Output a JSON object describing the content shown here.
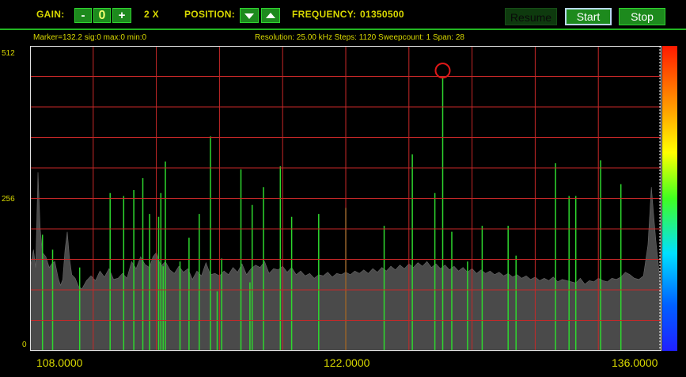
{
  "toolbar": {
    "gain_label": "GAIN:",
    "gain_minus": "-",
    "gain_value": "0",
    "gain_plus": "+",
    "multiplier": "2 X",
    "position_label": "POSITION:",
    "position_down_icon": "triangle-down-icon",
    "position_up_icon": "triangle-up-icon",
    "frequency_label": "FREQUENCY:",
    "frequency_value": "01350500",
    "resume_label": "Resume",
    "start_label": "Start",
    "stop_label": "Stop"
  },
  "info": {
    "marker": "Marker=132.2 sig:0 max:0 min:0",
    "resolution": "Resolution: 25.00 kHz Steps: 1120 Sweepcount: 1 Span: 28"
  },
  "colors": {
    "label": "#d8d800",
    "grid": "#c82828",
    "trace": "#4a4a4a",
    "peaks": "#2ed82e",
    "button": "#1d8a1d",
    "marker": "#e01818"
  },
  "chart_data": {
    "type": "area",
    "xlim": [
      108,
      136
    ],
    "ylim": [
      0,
      512
    ],
    "y_ticks": [
      "512",
      "256",
      "0"
    ],
    "x_ticks": [
      "108.0000",
      "122.0000",
      "136.0000"
    ],
    "grid": true,
    "marker_x": 132.2,
    "noise_floor": 135,
    "spectrum": [
      [
        108.0,
        138
      ],
      [
        108.15,
        170
      ],
      [
        108.25,
        140
      ],
      [
        108.35,
        300
      ],
      [
        108.45,
        205
      ],
      [
        108.55,
        165
      ],
      [
        108.7,
        158
      ],
      [
        108.85,
        140
      ],
      [
        109.0,
        148
      ],
      [
        109.1,
        150
      ],
      [
        109.25,
        122
      ],
      [
        109.35,
        110
      ],
      [
        109.45,
        120
      ],
      [
        109.55,
        170
      ],
      [
        109.65,
        200
      ],
      [
        109.75,
        155
      ],
      [
        109.85,
        128
      ],
      [
        110.0,
        122
      ],
      [
        110.15,
        108
      ],
      [
        110.3,
        104
      ],
      [
        110.5,
        118
      ],
      [
        110.7,
        126
      ],
      [
        110.9,
        118
      ],
      [
        111.1,
        134
      ],
      [
        111.3,
        124
      ],
      [
        111.5,
        138
      ],
      [
        111.7,
        120
      ],
      [
        111.9,
        122
      ],
      [
        112.1,
        130
      ],
      [
        112.3,
        122
      ],
      [
        112.5,
        150
      ],
      [
        112.7,
        138
      ],
      [
        112.9,
        158
      ],
      [
        113.1,
        145
      ],
      [
        113.3,
        140
      ],
      [
        113.45,
        158
      ],
      [
        113.6,
        165
      ],
      [
        113.8,
        142
      ],
      [
        114.0,
        150
      ],
      [
        114.2,
        136
      ],
      [
        114.4,
        130
      ],
      [
        114.6,
        142
      ],
      [
        114.8,
        132
      ],
      [
        115.0,
        138
      ],
      [
        115.2,
        120
      ],
      [
        115.4,
        134
      ],
      [
        115.6,
        126
      ],
      [
        115.8,
        148
      ],
      [
        116.0,
        128
      ],
      [
        116.2,
        130
      ],
      [
        116.4,
        126
      ],
      [
        116.6,
        134
      ],
      [
        116.8,
        128
      ],
      [
        117.0,
        140
      ],
      [
        117.2,
        132
      ],
      [
        117.4,
        146
      ],
      [
        117.6,
        128
      ],
      [
        117.8,
        138
      ],
      [
        118.0,
        144
      ],
      [
        118.2,
        140
      ],
      [
        118.4,
        150
      ],
      [
        118.6,
        130
      ],
      [
        118.8,
        138
      ],
      [
        119.0,
        136
      ],
      [
        119.2,
        142
      ],
      [
        119.4,
        132
      ],
      [
        119.6,
        140
      ],
      [
        119.8,
        128
      ],
      [
        120.0,
        134
      ],
      [
        120.2,
        126
      ],
      [
        120.4,
        130
      ],
      [
        120.6,
        122
      ],
      [
        120.8,
        128
      ],
      [
        121.0,
        126
      ],
      [
        121.2,
        132
      ],
      [
        121.4,
        124
      ],
      [
        121.6,
        130
      ],
      [
        121.8,
        128
      ],
      [
        122.0,
        132
      ],
      [
        122.2,
        128
      ],
      [
        122.4,
        134
      ],
      [
        122.6,
        130
      ],
      [
        122.8,
        136
      ],
      [
        123.0,
        130
      ],
      [
        123.2,
        138
      ],
      [
        123.4,
        132
      ],
      [
        123.6,
        140
      ],
      [
        123.8,
        134
      ],
      [
        124.0,
        142
      ],
      [
        124.2,
        136
      ],
      [
        124.4,
        144
      ],
      [
        124.6,
        138
      ],
      [
        124.8,
        146
      ],
      [
        125.0,
        140
      ],
      [
        125.2,
        148
      ],
      [
        125.4,
        142
      ],
      [
        125.6,
        150
      ],
      [
        125.8,
        140
      ],
      [
        126.0,
        146
      ],
      [
        126.2,
        138
      ],
      [
        126.4,
        144
      ],
      [
        126.6,
        136
      ],
      [
        126.8,
        142
      ],
      [
        127.0,
        134
      ],
      [
        127.2,
        140
      ],
      [
        127.4,
        132
      ],
      [
        127.6,
        138
      ],
      [
        127.8,
        130
      ],
      [
        128.0,
        136
      ],
      [
        128.2,
        130
      ],
      [
        128.4,
        134
      ],
      [
        128.6,
        128
      ],
      [
        128.8,
        132
      ],
      [
        129.0,
        126
      ],
      [
        129.2,
        130
      ],
      [
        129.4,
        124
      ],
      [
        129.6,
        128
      ],
      [
        129.8,
        122
      ],
      [
        130.0,
        126
      ],
      [
        130.2,
        120
      ],
      [
        130.4,
        124
      ],
      [
        130.6,
        118
      ],
      [
        130.8,
        122
      ],
      [
        131.0,
        118
      ],
      [
        131.2,
        124
      ],
      [
        131.4,
        116
      ],
      [
        131.6,
        120
      ],
      [
        131.8,
        118
      ],
      [
        132.0,
        116
      ],
      [
        132.2,
        114
      ],
      [
        132.4,
        122
      ],
      [
        132.6,
        112
      ],
      [
        132.8,
        118
      ],
      [
        133.0,
        116
      ],
      [
        133.2,
        122
      ],
      [
        133.4,
        118
      ],
      [
        133.6,
        116
      ],
      [
        133.8,
        122
      ],
      [
        134.0,
        120
      ],
      [
        134.2,
        124
      ],
      [
        134.4,
        132
      ],
      [
        134.6,
        128
      ],
      [
        134.8,
        122
      ],
      [
        135.0,
        120
      ],
      [
        135.2,
        126
      ],
      [
        135.4,
        178
      ],
      [
        135.55,
        275
      ],
      [
        135.65,
        230
      ],
      [
        135.75,
        185
      ],
      [
        135.85,
        150
      ],
      [
        135.95,
        110
      ],
      [
        136.0,
        110
      ]
    ],
    "peaks": [
      [
        108.55,
        195
      ],
      [
        109.0,
        170
      ],
      [
        110.2,
        140
      ],
      [
        111.55,
        265
      ],
      [
        112.15,
        260
      ],
      [
        112.6,
        270
      ],
      [
        113.0,
        290
      ],
      [
        113.3,
        230
      ],
      [
        113.7,
        225
      ],
      [
        113.8,
        265
      ],
      [
        113.9,
        142
      ],
      [
        114.0,
        318
      ],
      [
        114.65,
        150
      ],
      [
        115.05,
        190
      ],
      [
        115.5,
        230
      ],
      [
        116.0,
        360
      ],
      [
        116.3,
        100
      ],
      [
        116.5,
        155
      ],
      [
        117.35,
        305
      ],
      [
        117.75,
        115
      ],
      [
        117.85,
        245
      ],
      [
        118.35,
        275
      ],
      [
        119.1,
        310
      ],
      [
        119.6,
        225
      ],
      [
        120.8,
        230
      ],
      [
        122.0,
        240
      ],
      [
        123.7,
        210
      ],
      [
        124.95,
        330
      ],
      [
        125.95,
        265
      ],
      [
        126.3,
        460
      ],
      [
        126.7,
        200
      ],
      [
        127.4,
        150
      ],
      [
        128.05,
        210
      ],
      [
        129.2,
        210
      ],
      [
        129.55,
        160
      ],
      [
        131.3,
        315
      ],
      [
        131.9,
        260
      ],
      [
        132.2,
        260
      ],
      [
        133.3,
        320
      ],
      [
        134.2,
        280
      ]
    ]
  }
}
